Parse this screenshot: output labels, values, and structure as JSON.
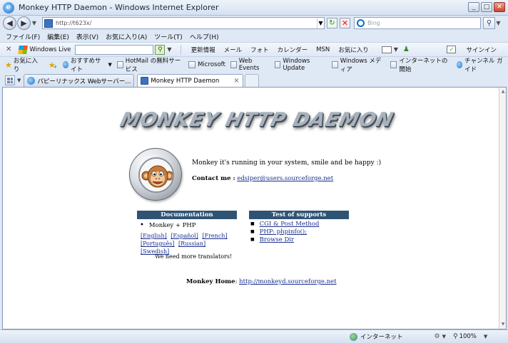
{
  "window": {
    "title": "Monkey HTTP Daemon - Windows Internet Explorer",
    "buttons": {
      "minimize": "_",
      "maximize": "□",
      "close": "✕"
    }
  },
  "address_bar": {
    "url": "http://t623x/",
    "search_placeholder": "Bing"
  },
  "menu": [
    "ファイル(F)",
    "編集(E)",
    "表示(V)",
    "お気に入り(A)",
    "ツール(T)",
    "ヘルプ(H)"
  ],
  "wl_toolbar": {
    "brand": "Windows Live",
    "links": [
      "更新情報",
      "メール",
      "フォト",
      "カレンダー",
      "MSN",
      "お気に入り"
    ],
    "signin": "サインイン"
  },
  "favorites_bar": {
    "label": "お気に入り",
    "items": [
      "おすすめサイト",
      "HotMail の無料サービス",
      "Microsoft",
      "Web Events",
      "Windows Update",
      "Windows メディア",
      "インターネットの開始",
      "チャンネル ガイド"
    ]
  },
  "tabs": [
    {
      "label": "パピーリナックス  Webサーバー..."
    },
    {
      "label": "Monkey HTTP Daemon",
      "close": "×"
    }
  ],
  "page": {
    "logo_text": "MONKEY HTTP DAEMON",
    "happy": "Monkey it's running in your system, smile and be happy :)",
    "contact_label": "Contact me :",
    "contact_email": "edsiper@users.sourceforge.net",
    "documentation": {
      "header": "Documentation",
      "item": "Monkey + PHP",
      "languages": [
        "[English]",
        "[Español]",
        "[French]",
        "[Português]",
        "[Russian]",
        "[Swedish]"
      ],
      "note": "We need more translators!"
    },
    "tests": {
      "header": "Test of supports",
      "items": [
        "CGI & Post Method",
        "PHP: phpinfo();",
        "Browse Dir"
      ]
    },
    "home_label": "Monkey Home",
    "home_url": "http://monkeyd.sourceforge.net"
  },
  "status_bar": {
    "zone": "インターネット",
    "zoom": "100%"
  },
  "colors": {
    "section_header_bg": "#2f5373",
    "link": "#1a2f8c",
    "chrome": "#dfe8f5"
  }
}
